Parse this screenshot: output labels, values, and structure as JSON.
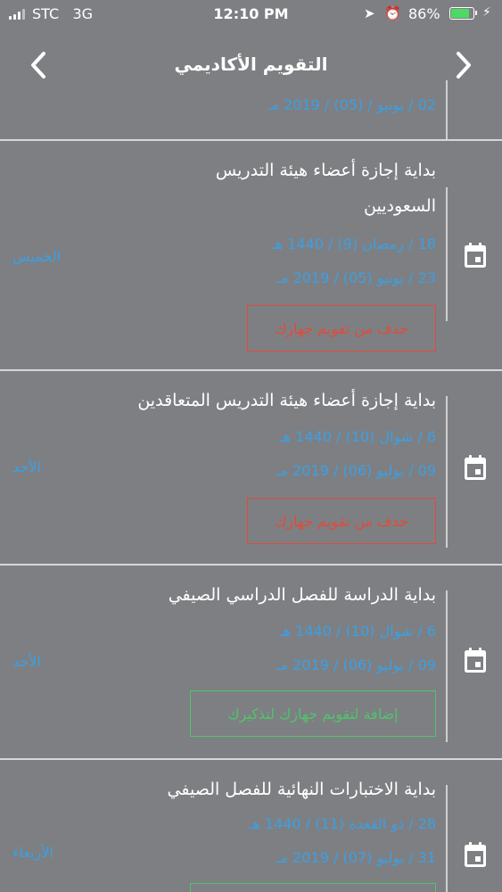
{
  "status_bar": {
    "carrier": "STC",
    "network": "3G",
    "time": "12:10 PM",
    "battery": "86%",
    "battery_level": 0.86,
    "icons": [
      "signal-icon",
      "location-arrow-icon",
      "alarm-icon",
      "battery-icon",
      "charging-bolt-icon"
    ]
  },
  "nav": {
    "title": "التقويم الأكاديمي",
    "left_icon": "chevron-left-icon",
    "right_icon": "chevron-right-icon"
  },
  "events": [
    {
      "title_lines": [],
      "hijri": "",
      "gregorian": "02 / يونيو / (05) / 2019 مـ",
      "day": "",
      "action": ""
    },
    {
      "title_lines": [
        "بداية إجازة أعضاء هيئة التدريس",
        "السعوديين"
      ],
      "hijri": "18 / رمضان (9) / 1440 هـ",
      "gregorian": "23 / يونيو  (05) / 2019 مـ",
      "day": "الخميس",
      "action": "حذف من تقويم جهازك",
      "action_type": "remove"
    },
    {
      "title_lines": [
        "بداية إجازة أعضاء هيئة التدريس المتعاقدين"
      ],
      "hijri": "6 / شوال (10) / 1440 هـ",
      "gregorian": "09 / يوليو  (06) / 2019 مـ",
      "day": "الأحد",
      "action": "حذف من تقويم جهازك",
      "action_type": "remove"
    },
    {
      "title_lines": [
        "بداية الدراسة للفصل الدراسي الصيفي"
      ],
      "hijri": "6 / شوال (10) / 1440 هـ",
      "gregorian": "09 / يوليو  (06) / 2019 مـ",
      "day": "الأحد",
      "action": "إضافة لتقويم جهازك لتذكيرك",
      "action_type": "add"
    },
    {
      "title_lines": [
        "بداية الاختبارات النهائية للفصل الصيفي"
      ],
      "hijri": "28 / ذو القعدة (11) / 1440 هـ",
      "gregorian": "31 / يوليو  (07) / 2019 مـ",
      "day": "الأربعاء",
      "action": "",
      "action_type": "add"
    }
  ],
  "colors": {
    "background": "#7e7f82",
    "date_text": "#3aa0e6",
    "remove_action": "#e34a3a",
    "add_action": "#4dc66a",
    "separator": "#d7d7d9"
  }
}
